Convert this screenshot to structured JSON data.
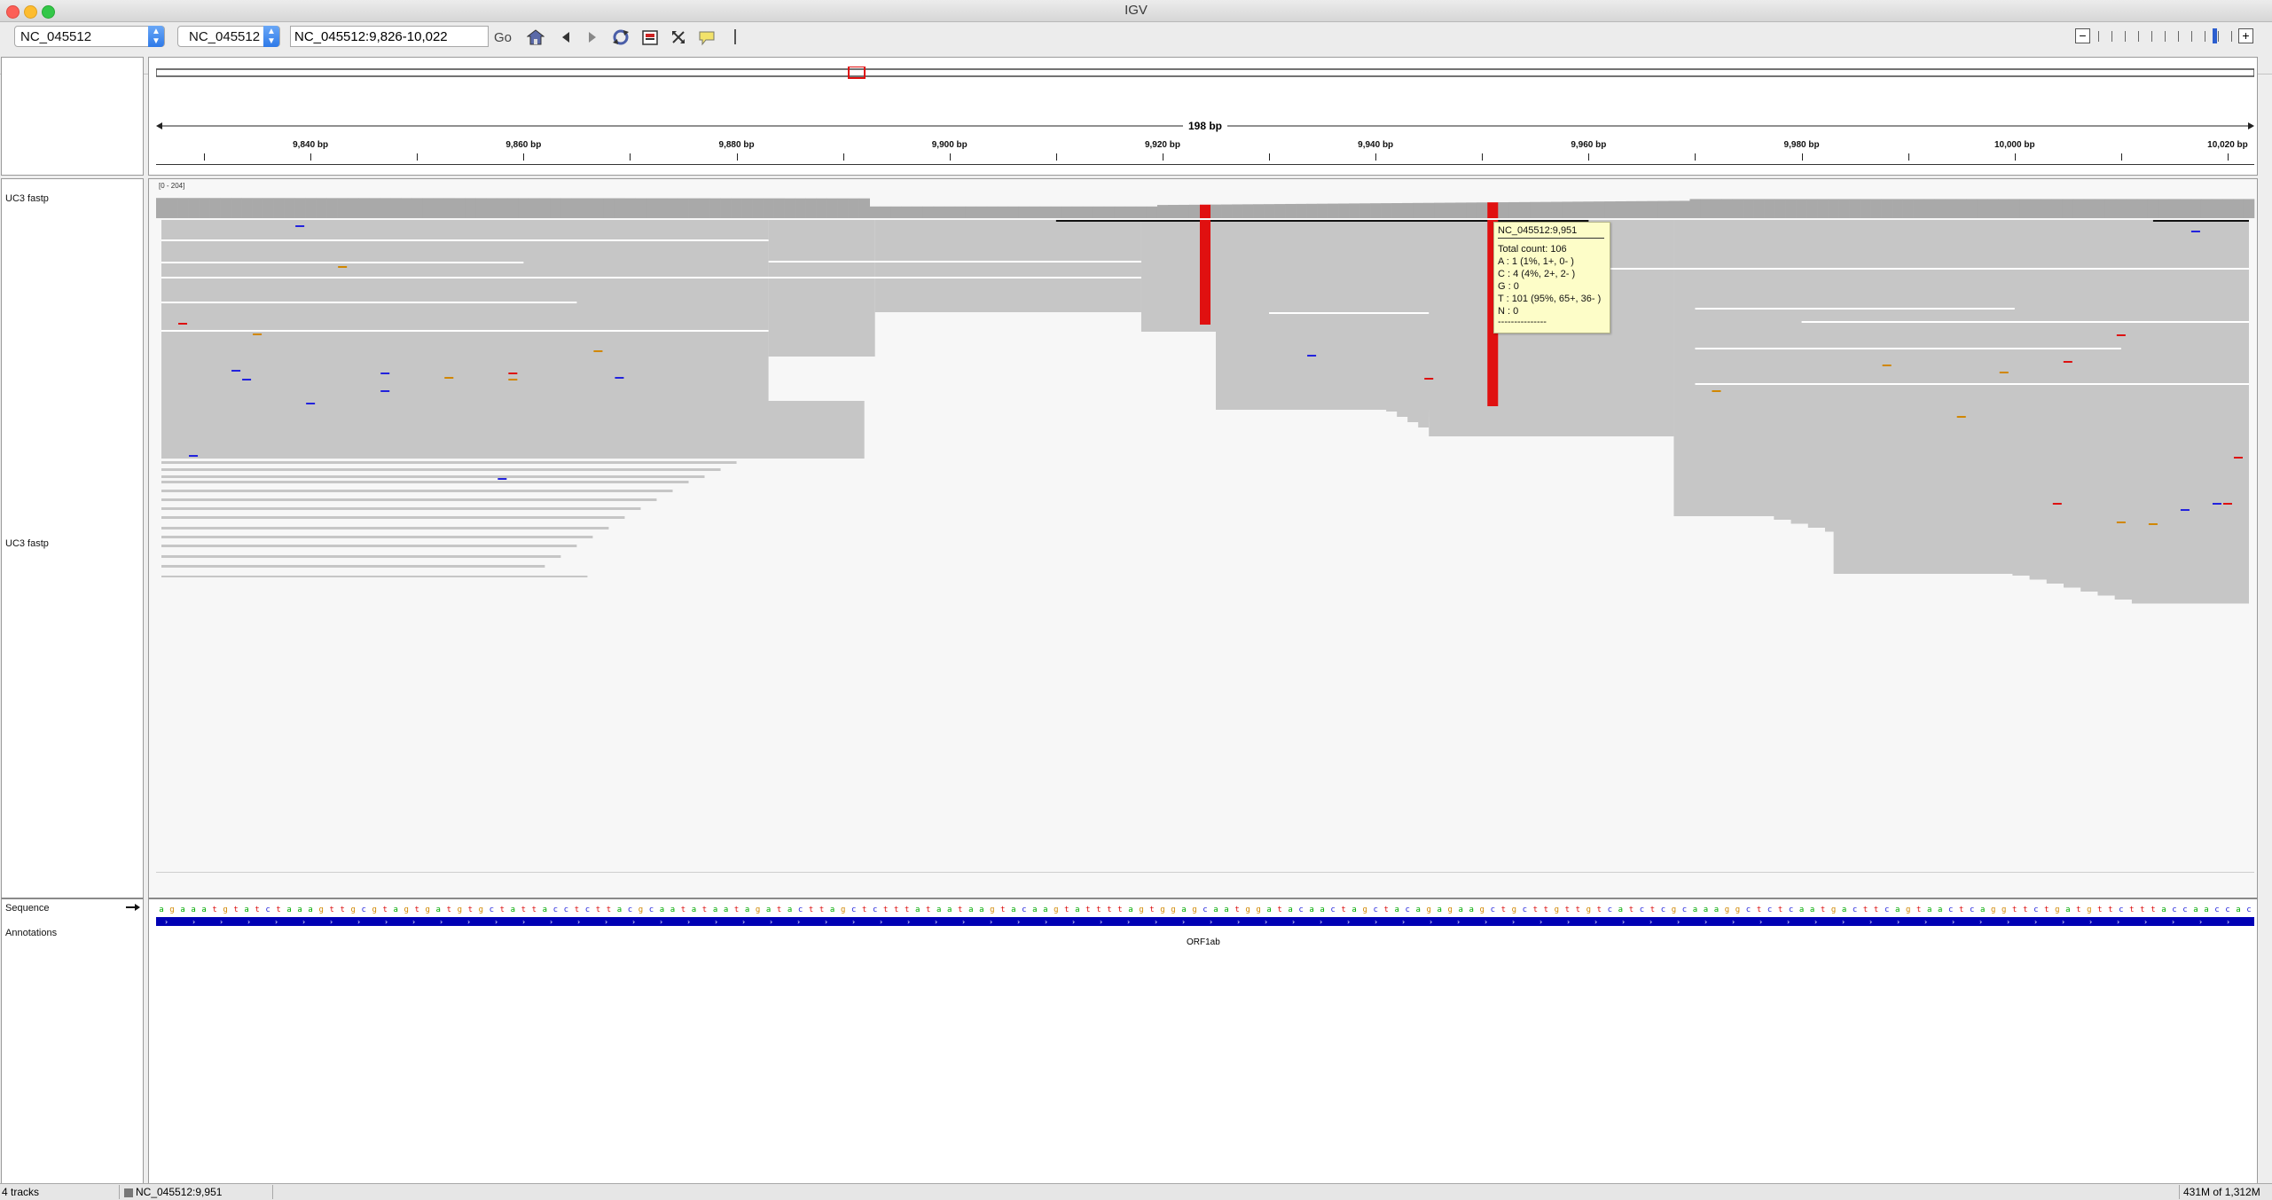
{
  "window": {
    "title": "IGV",
    "colors": {
      "close": "#fc5f57",
      "minimize": "#fdbc2e",
      "zoom": "#33c748"
    }
  },
  "toolbar": {
    "genome": "NC_045512",
    "chromosome": "NC_045512",
    "locus": "NC_045512:9,826-10,022",
    "go_label": "Go",
    "icons": [
      "home-icon",
      "back-icon",
      "forward-icon",
      "refresh-icon",
      "region-of-interest-icon",
      "resize-icon",
      "popup-info-icon",
      "ruler-icon"
    ],
    "zoom_out": "−",
    "zoom_in": "+"
  },
  "ruler": {
    "span_label": "198 bp",
    "ticks": [
      "9,840 bp",
      "9,860 bp",
      "9,880 bp",
      "9,900 bp",
      "9,920 bp",
      "9,940 bp",
      "9,960 bp",
      "9,980 bp",
      "10,000 bp",
      "10,020 bp"
    ],
    "tick_values": [
      9840,
      9860,
      9880,
      9900,
      9920,
      9940,
      9960,
      9980,
      10000,
      10020
    ],
    "view_start": 9826,
    "view_end": 10022
  },
  "tracks": {
    "coverage_label": "UC3 fastp",
    "coverage_range": "[0 - 204]",
    "alignment_label": "UC3 fastp",
    "sequence_label": "Sequence",
    "annotations_label": "Annotations",
    "gene_name": "ORF1ab",
    "sequence": "agaaatgtatctaaagttgcgtagtgatgtgctattacctcttacgcaatataatagatacttagctctttataataagtacaagtattttagtggagcaatggatacaactagctacagagaagctgcttgttgtcatctcgcaaaggctctcaatgacttcagtaactcaggttctgatgttctttaccaaccac",
    "base_colors": {
      "a": "#00aa00",
      "c": "#2222dd",
      "g": "#d18700",
      "t": "#dd1111"
    },
    "mismatch_positions": [
      9924,
      9951
    ]
  },
  "popup": {
    "header": "NC_045512:9,951",
    "total": "Total count: 106",
    "a": "A : 1 (1%, 1+, 0- )",
    "c": "C : 4 (4%, 2+, 2- )",
    "g": "G : 0",
    "t": "T : 101 (95%, 65+, 36- )",
    "n": "N : 0",
    "divider": "---------------"
  },
  "status": {
    "track_count": "4 tracks",
    "position": "NC_045512:9,951",
    "memory": "431M of 1,312M"
  }
}
